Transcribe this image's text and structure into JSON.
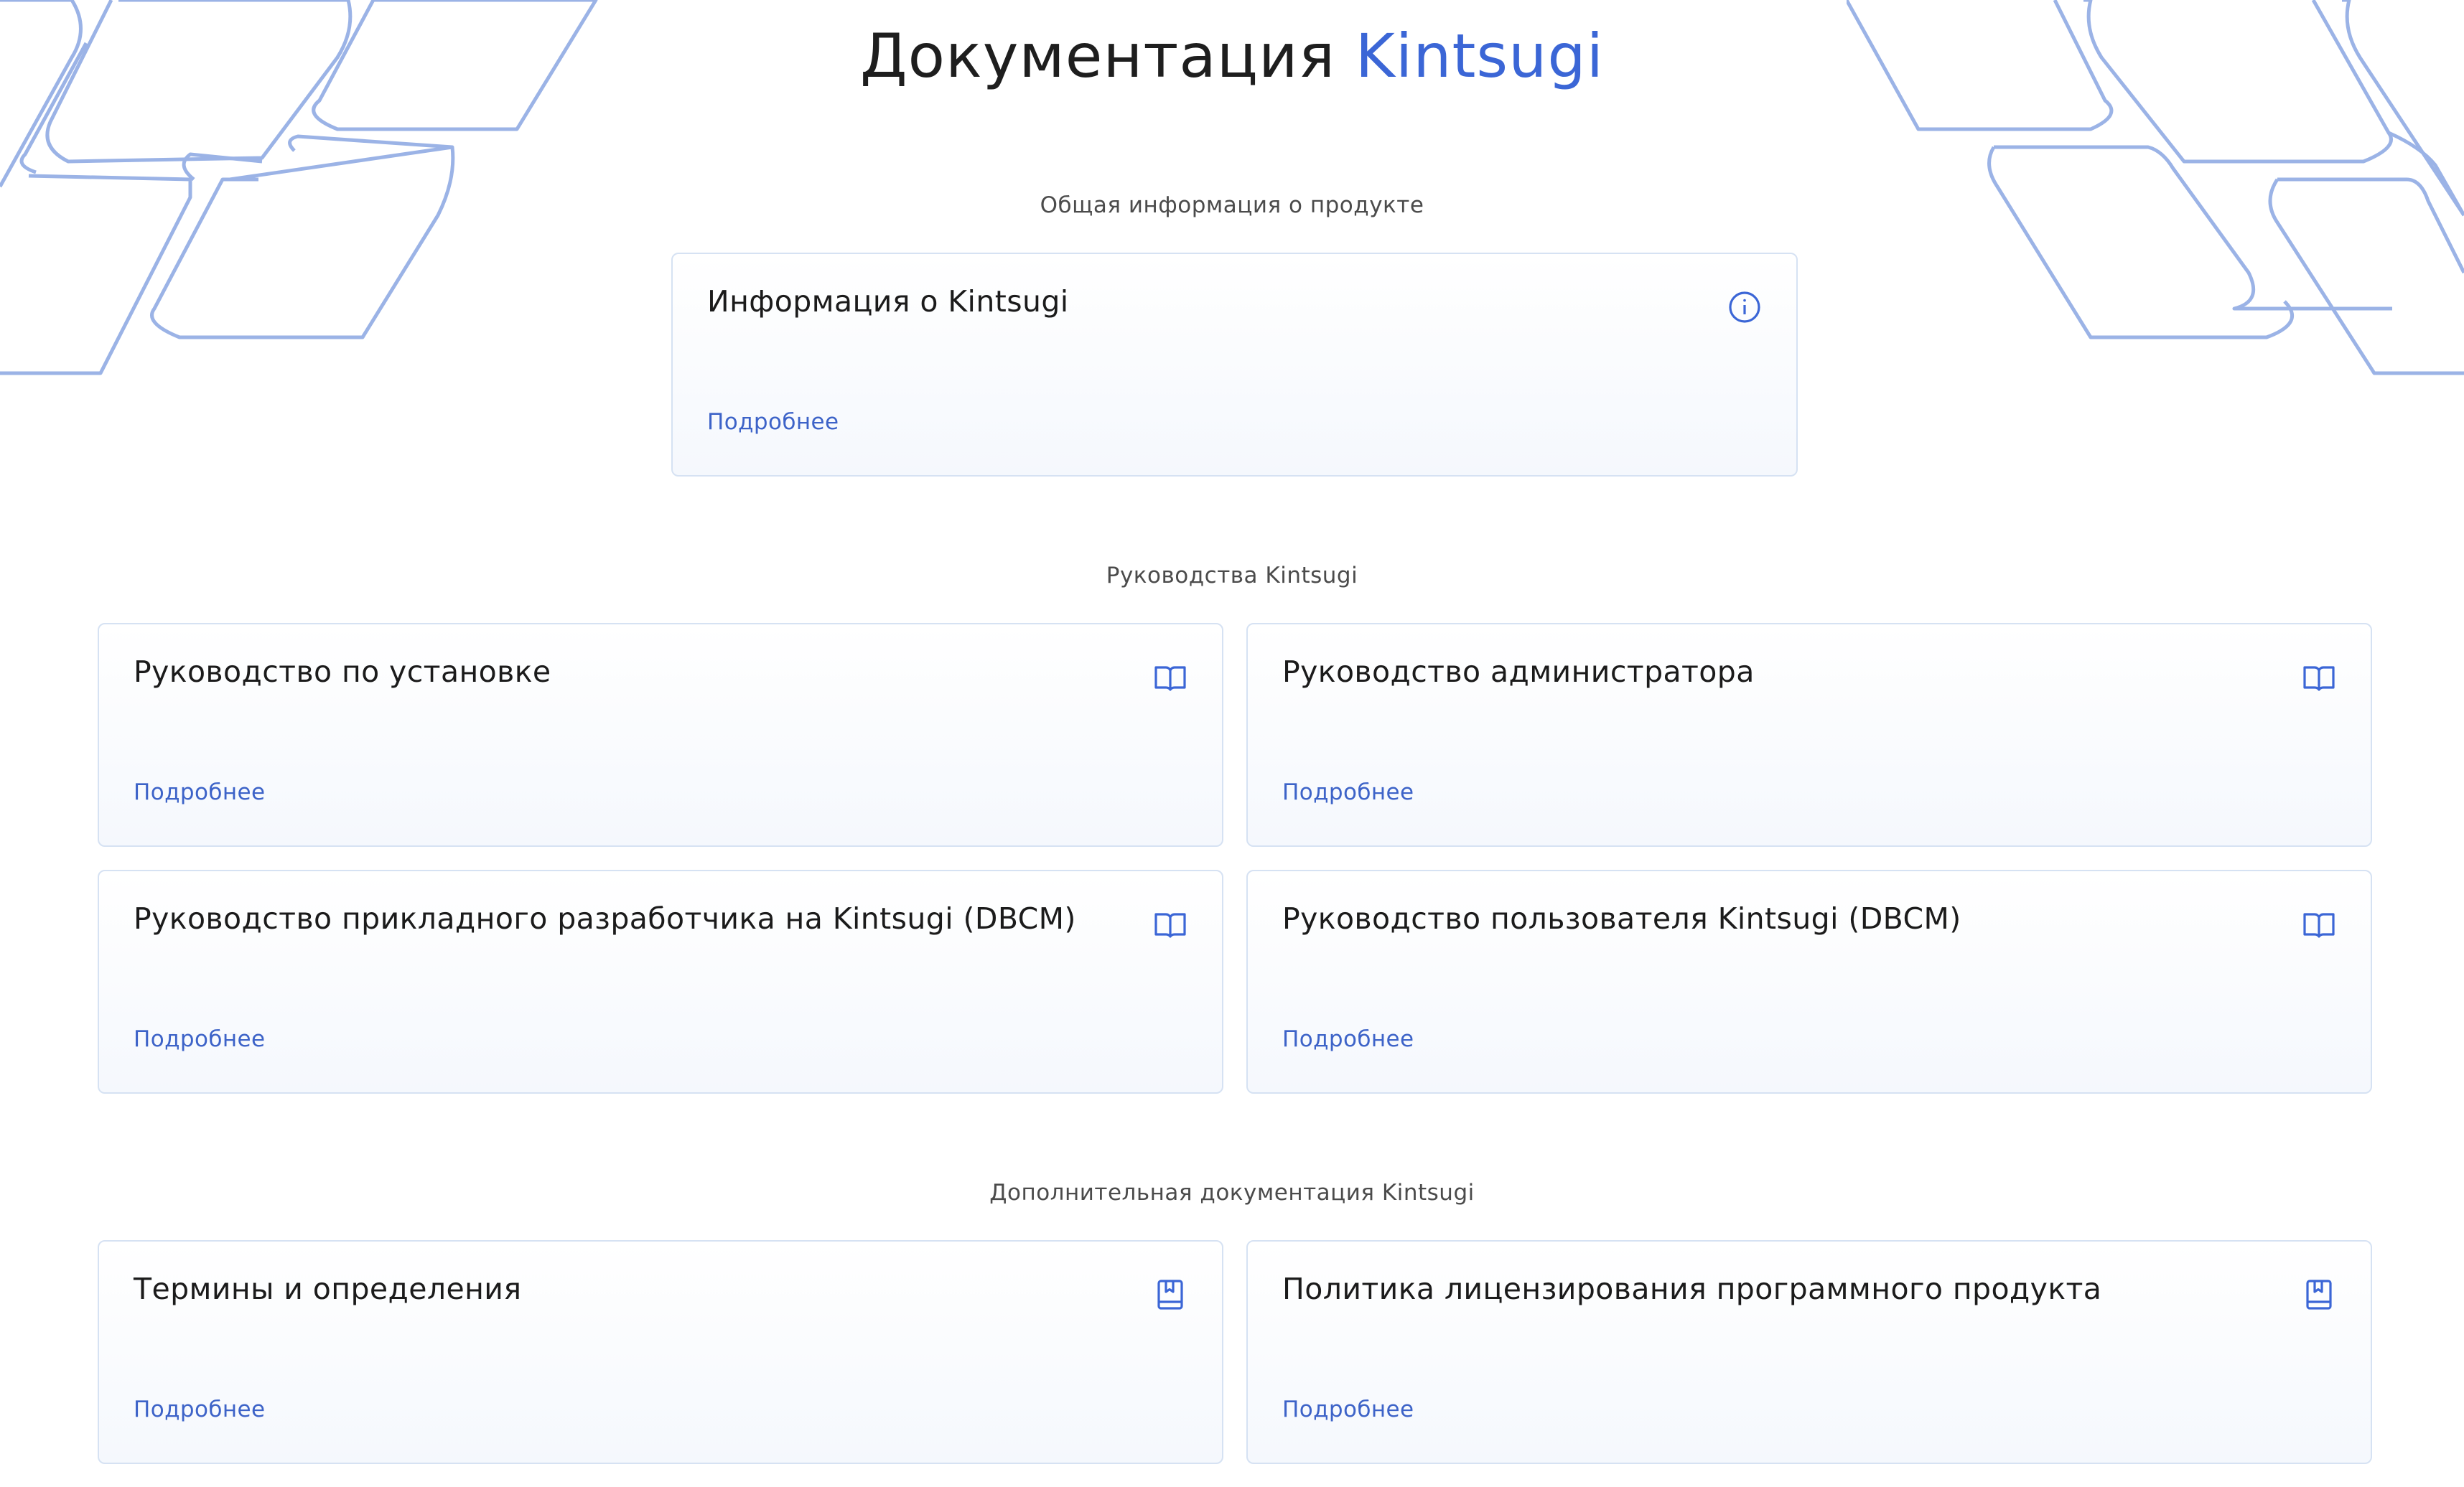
{
  "header": {
    "title_prefix": "Документация",
    "title_accent": "Kintsugi"
  },
  "colors": {
    "accent": "#3b66d6",
    "link": "#3d63c8",
    "card_border": "#d6e2f3",
    "decoration": "#9bb3e6"
  },
  "sections": [
    {
      "label": "Общая информация о продукте",
      "cards": [
        {
          "title": "Информация о Kintsugi",
          "link": "Подробнее",
          "icon": "info-icon"
        }
      ]
    },
    {
      "label": "Руководства Kintsugi",
      "cards": [
        {
          "title": "Руководство по установке",
          "link": "Подробнее",
          "icon": "book-open-icon"
        },
        {
          "title": "Руководство администратора",
          "link": "Подробнее",
          "icon": "book-open-icon"
        },
        {
          "title": "Руководство прикладного разработчика на Kintsugi (DBCM)",
          "link": "Подробнее",
          "icon": "book-open-icon"
        },
        {
          "title": "Руководство пользователя Kintsugi (DBCM)",
          "link": "Подробнее",
          "icon": "book-open-icon"
        }
      ]
    },
    {
      "label": "Дополнительная документация Kintsugi",
      "cards": [
        {
          "title": "Термины и определения",
          "link": "Подробнее",
          "icon": "bookmark-book-icon"
        },
        {
          "title": "Политика лицензирования программного продукта",
          "link": "Подробнее",
          "icon": "bookmark-book-icon"
        }
      ]
    }
  ]
}
